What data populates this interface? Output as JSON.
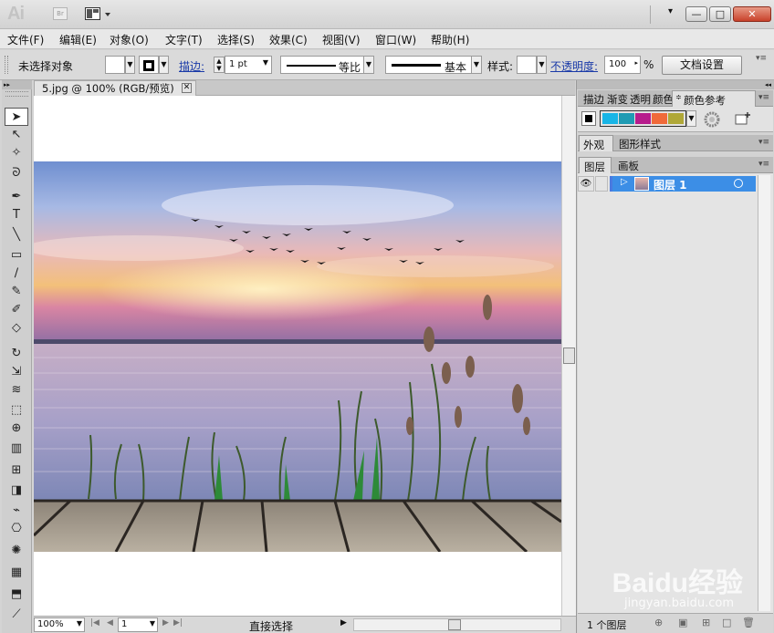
{
  "app": {
    "logo": "Ai",
    "bridge": "Br"
  },
  "window": {
    "minimize": "—",
    "maximize": "□",
    "close": "✕",
    "overflow": "▾"
  },
  "menu": [
    "文件(F)",
    "编辑(E)",
    "对象(O)",
    "文字(T)",
    "选择(S)",
    "效果(C)",
    "视图(V)",
    "窗口(W)",
    "帮助(H)"
  ],
  "control": {
    "no_selection": "未选择对象",
    "stroke_label": "描边:",
    "stroke_weight": "1 pt",
    "profile": "等比",
    "brush": "基本",
    "style_label": "样式:",
    "opacity_label": "不透明度:",
    "opacity_value": "100",
    "percent": "%",
    "doc_setup": "文档设置"
  },
  "document": {
    "tab_title": "5.jpg @ 100% (RGB/预览)",
    "tab_close": "✕"
  },
  "status": {
    "zoom": "100%",
    "page": "1",
    "tool": "直接选择"
  },
  "panels": {
    "top_tabs": [
      "描边",
      "渐变",
      "透明",
      "颜色",
      "颜色参考"
    ],
    "guide_colors": [
      "#18b5e6",
      "#1f9bb3",
      "#b71c8c",
      "#f06a3a",
      "#b0a838"
    ],
    "mid_tabs": [
      "外观",
      "图形样式"
    ],
    "layer_tabs": [
      "图层",
      "画板"
    ],
    "layer_name": "图层 1",
    "layer_count": "1 个图层"
  },
  "watermark": {
    "brand": "Baidu经验",
    "url": "jingyan.baidu.com"
  },
  "tools": [
    "selection-tool",
    "direct-selection-tool",
    "magic-wand-tool",
    "lasso-tool",
    "pen-tool",
    "type-tool",
    "line-tool",
    "rectangle-tool",
    "paintbrush-tool",
    "pencil-tool",
    "blob-brush-tool",
    "eraser-tool",
    "rotate-tool",
    "scale-tool",
    "warp-tool",
    "free-transform-tool",
    "shape-builder-tool",
    "perspective-grid-tool",
    "mesh-tool",
    "gradient-tool",
    "eyedropper-tool",
    "blend-tool",
    "symbol-sprayer-tool",
    "column-graph-tool",
    "artboard-tool",
    "slice-tool"
  ]
}
